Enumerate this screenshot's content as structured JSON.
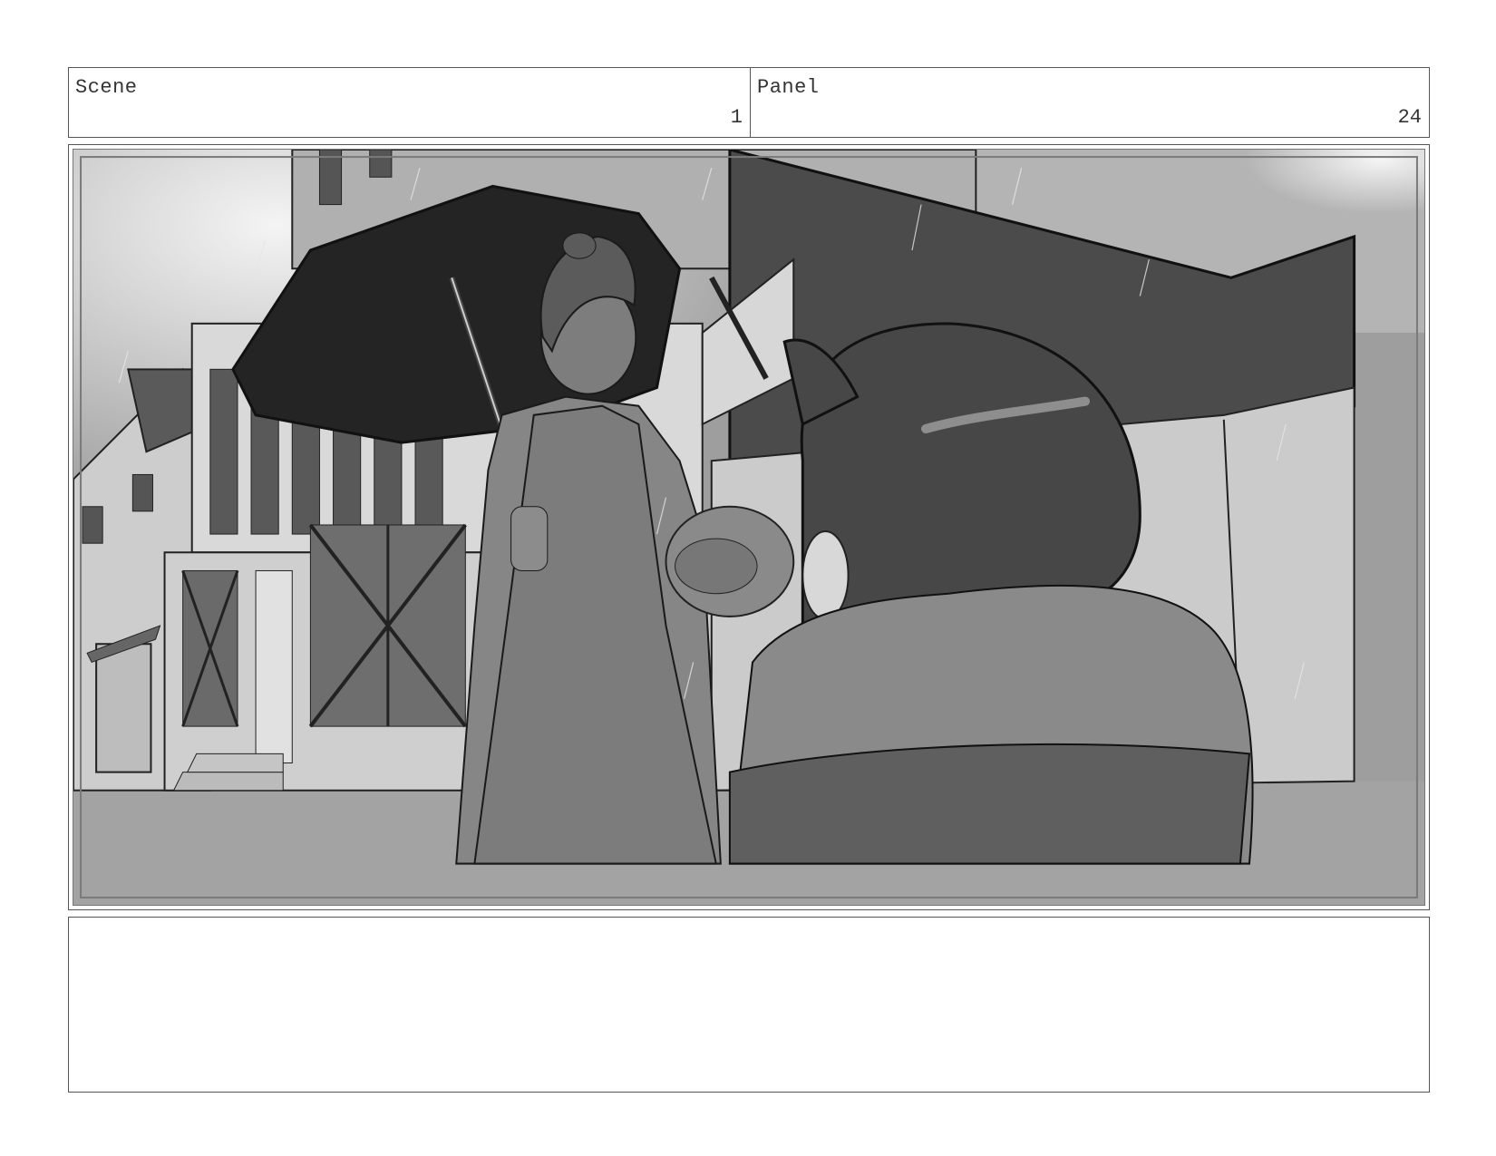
{
  "header": {
    "scene_label": "Scene",
    "scene_value": "1",
    "panel_label": "Panel",
    "panel_value": "24"
  },
  "notes": {
    "text": ""
  }
}
